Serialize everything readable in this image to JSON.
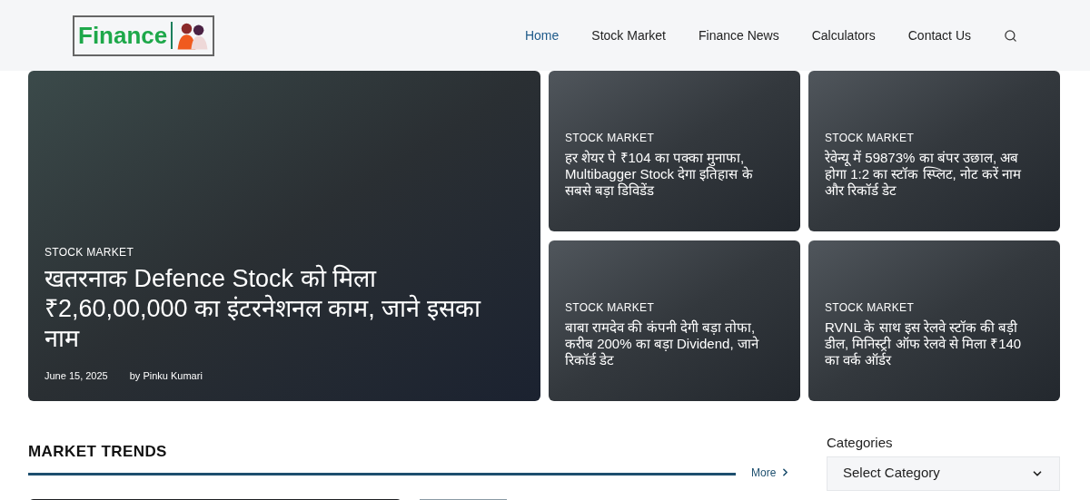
{
  "logo": {
    "text": "Finance"
  },
  "nav": [
    {
      "label": "Home",
      "selected": true
    },
    {
      "label": "Stock Market",
      "selected": false
    },
    {
      "label": "Finance News",
      "selected": false
    },
    {
      "label": "Calculators",
      "selected": false
    },
    {
      "label": "Contact Us",
      "selected": false
    }
  ],
  "featured": {
    "category": "STOCK MARKET",
    "title": "खतरनाक Defence Stock को मिला ₹2,60,00,000 का इंटरनेशनल काम, जाने इसका नाम",
    "date": "June 15, 2025",
    "author": "by Pinku Kumari"
  },
  "cards": [
    {
      "category": "STOCK MARKET",
      "title": "हर शेयर पे ₹104 का पक्का मुनाफा, Multibagger Stock देगा इतिहास के सबसे बड़ा डिविडेंड"
    },
    {
      "category": "STOCK MARKET",
      "title": "रेवेन्यू में 59873% का बंपर उछाल, अब होगा 1:2 का स्टॉक स्प्लिट, नोट करें नाम और रिकॉर्ड डेट"
    },
    {
      "category": "STOCK MARKET",
      "title": "बाबा रामदेव की कंपनी देगी बड़ा तोफा, करीब 200% का बड़ा Dividend, जाने रिकॉर्ड डेट"
    },
    {
      "category": "STOCK MARKET",
      "title": "RVNL के साथ इस रेलवे स्टॉक की बड़ी डील, मिनिस्ट्री ऑफ रेलवे से मिला ₹140 का वर्क ऑर्डर"
    }
  ],
  "section": {
    "title": "MARKET TRENDS",
    "more": "More"
  },
  "sidebar": {
    "heading": "Categories",
    "select": "Select Category"
  }
}
